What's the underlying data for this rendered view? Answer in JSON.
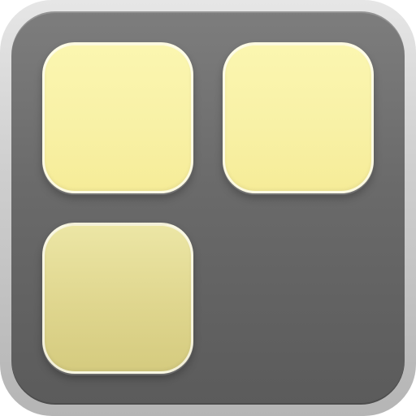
{
  "app_icon": {
    "tiles": [
      {
        "state": "bright",
        "color": "#f8f1a6"
      },
      {
        "state": "bright",
        "color": "#f8f1a6"
      },
      {
        "state": "dim",
        "color": "#dfd68e"
      }
    ],
    "colors": {
      "frame": "#cfcfcf",
      "body": "#6a6a6a",
      "tile_bright": "#f8f1a6",
      "tile_dim": "#dfd68e"
    }
  }
}
